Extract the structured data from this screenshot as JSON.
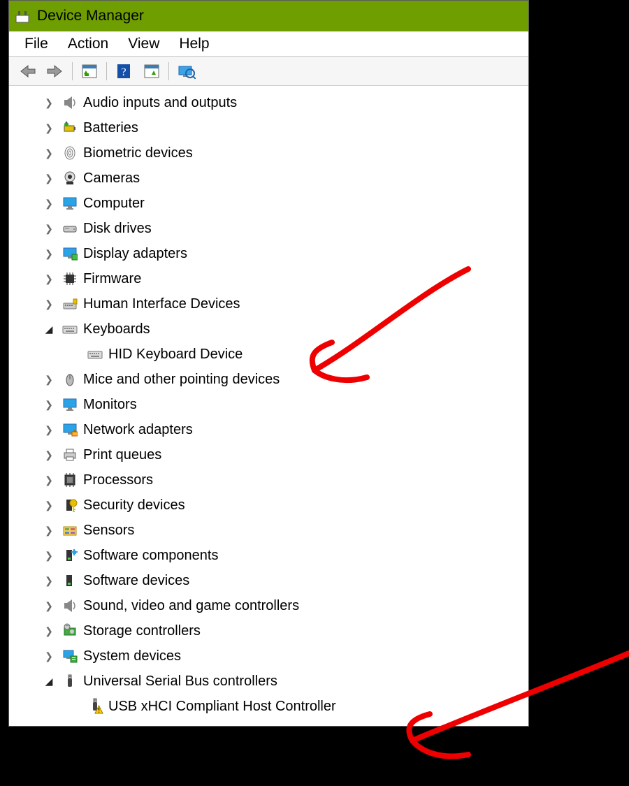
{
  "window": {
    "title": "Device Manager"
  },
  "menu": {
    "file": "File",
    "action": "Action",
    "view": "View",
    "help": "Help"
  },
  "tree": [
    {
      "expanded": false,
      "icon": "audio",
      "label": "Audio inputs and outputs"
    },
    {
      "expanded": false,
      "icon": "battery",
      "label": "Batteries"
    },
    {
      "expanded": false,
      "icon": "finger",
      "label": "Biometric devices"
    },
    {
      "expanded": false,
      "icon": "camera",
      "label": "Cameras"
    },
    {
      "expanded": false,
      "icon": "monitor",
      "label": "Computer"
    },
    {
      "expanded": false,
      "icon": "disk",
      "label": "Disk drives"
    },
    {
      "expanded": false,
      "icon": "display",
      "label": "Display adapters"
    },
    {
      "expanded": false,
      "icon": "chip",
      "label": "Firmware"
    },
    {
      "expanded": false,
      "icon": "hid",
      "label": "Human Interface Devices"
    },
    {
      "expanded": true,
      "icon": "keyboard",
      "label": "Keyboards",
      "children": [
        {
          "icon": "keyboard",
          "label": "HID Keyboard Device",
          "warn": false
        }
      ]
    },
    {
      "expanded": false,
      "icon": "mouse",
      "label": "Mice and other pointing devices"
    },
    {
      "expanded": false,
      "icon": "monitor",
      "label": "Monitors"
    },
    {
      "expanded": false,
      "icon": "net",
      "label": "Network adapters"
    },
    {
      "expanded": false,
      "icon": "printer",
      "label": "Print queues"
    },
    {
      "expanded": false,
      "icon": "cpu",
      "label": "Processors"
    },
    {
      "expanded": false,
      "icon": "security",
      "label": "Security devices"
    },
    {
      "expanded": false,
      "icon": "sensor",
      "label": "Sensors"
    },
    {
      "expanded": false,
      "icon": "software",
      "label": "Software components"
    },
    {
      "expanded": false,
      "icon": "software2",
      "label": "Software devices"
    },
    {
      "expanded": false,
      "icon": "audio",
      "label": "Sound, video and game controllers"
    },
    {
      "expanded": false,
      "icon": "storage",
      "label": "Storage controllers"
    },
    {
      "expanded": false,
      "icon": "system",
      "label": "System devices"
    },
    {
      "expanded": true,
      "icon": "usb",
      "label": "Universal Serial Bus controllers",
      "children": [
        {
          "icon": "usb",
          "label": "USB xHCI Compliant Host Controller",
          "warn": true
        }
      ]
    }
  ]
}
